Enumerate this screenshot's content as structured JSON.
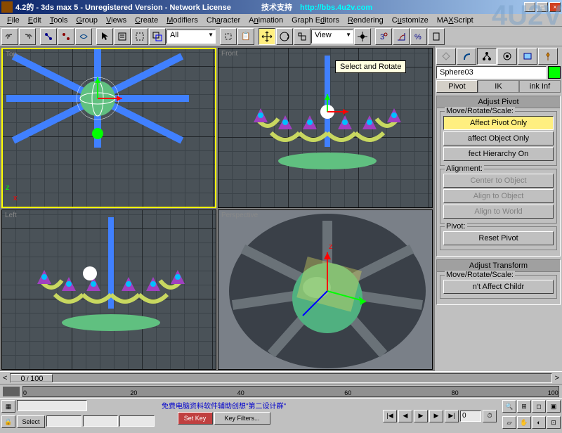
{
  "title": "4.2的 - 3ds max 5 - Unregistered Version - Network License",
  "support_label": "技术支持",
  "support_url": "http://bbs.4u2v.com",
  "menus": [
    "File",
    "Edit",
    "Tools",
    "Group",
    "Views",
    "Create",
    "Modifiers",
    "Character",
    "Animation",
    "Graph Editors",
    "Rendering",
    "Customize",
    "MAXScript"
  ],
  "toolbar": {
    "selection_set": "All",
    "view_label": "View",
    "tooltip": "Select and Rotate"
  },
  "viewports": {
    "top": "Top",
    "front": "Front",
    "left": "Left",
    "persp": "Perspective"
  },
  "object_name": "Sphere03",
  "sub_tabs": {
    "pivot": "Pivot",
    "ik": "IK",
    "link": "ink Inf"
  },
  "rollouts": {
    "adjust_pivot": "Adjust Pivot",
    "move_rotate_scale": "Move/Rotate/Scale:",
    "affect_pivot": "Affect Pivot Only",
    "affect_object": "affect Object Only",
    "affect_hierarchy": "fect Hierarchy On",
    "alignment": "Alignment:",
    "center_to_object": "Center to Object",
    "align_to_object": "Align to Object",
    "align_to_world": "Align to World",
    "pivot_group": "Pivot:",
    "reset_pivot": "Reset Pivot",
    "adjust_transform": "Adjust Transform",
    "dont_affect": "n't Affect Childr"
  },
  "timeline": {
    "current": "0",
    "total": "100",
    "ticks": [
      "0",
      "20",
      "40",
      "60",
      "80",
      "100"
    ]
  },
  "status": {
    "select_label": "Select",
    "set_key": "Set Key",
    "key_filters": "Key Filters...",
    "footer_text": "免费电脑资料软件辅助创想\"第二设计群\""
  },
  "watermark": "4U2V"
}
